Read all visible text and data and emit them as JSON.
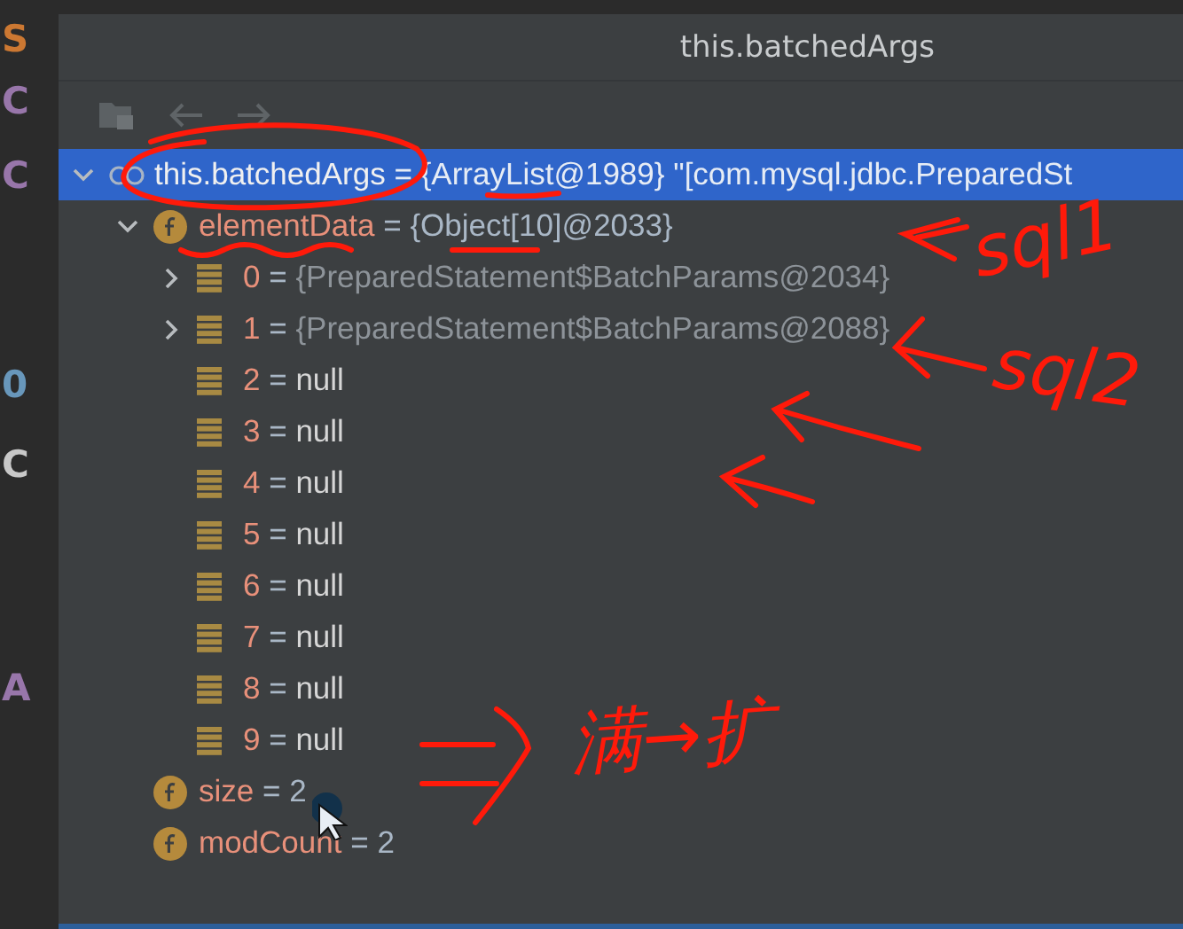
{
  "editor_gutter": [
    {
      "text": "S",
      "color": "#cc7832"
    },
    {
      "text": "C",
      "color": "#9876aa"
    },
    {
      "text": "C",
      "color": "#9876aa"
    },
    {
      "text": "0",
      "color": "#6897bb"
    },
    {
      "text": "C",
      "color": "#c8c8c8"
    },
    {
      "text": "A",
      "color": "#9876aa"
    }
  ],
  "popup": {
    "title": "this.batchedArgs"
  },
  "tree": [
    {
      "kind": "object",
      "name": "this.batchedArgs",
      "sep": "=",
      "value": "{ArrayList@1989} \"[com.mysql.jdbc.PreparedSt",
      "expanded": true,
      "selected": true,
      "children": [
        {
          "kind": "field",
          "name": "elementData",
          "sep": "=",
          "value": "{Object[10]@2033}",
          "expanded": true,
          "selected": false,
          "children": [
            {
              "kind": "element",
              "name": "0",
              "sep": "=",
              "value": "{PreparedStatement$BatchParams@2034}",
              "expanded": false,
              "selected": false
            },
            {
              "kind": "element",
              "name": "1",
              "sep": "=",
              "value": "{PreparedStatement$BatchParams@2088}",
              "expanded": false,
              "selected": false
            },
            {
              "kind": "element",
              "name": "2",
              "sep": "=",
              "value": "null",
              "selected": false
            },
            {
              "kind": "element",
              "name": "3",
              "sep": "=",
              "value": "null",
              "selected": false
            },
            {
              "kind": "element",
              "name": "4",
              "sep": "=",
              "value": "null",
              "selected": false
            },
            {
              "kind": "element",
              "name": "5",
              "sep": "=",
              "value": "null",
              "selected": false
            },
            {
              "kind": "element",
              "name": "6",
              "sep": "=",
              "value": "null",
              "selected": false
            },
            {
              "kind": "element",
              "name": "7",
              "sep": "=",
              "value": "null",
              "selected": false
            },
            {
              "kind": "element",
              "name": "8",
              "sep": "=",
              "value": "null",
              "selected": false
            },
            {
              "kind": "element",
              "name": "9",
              "sep": "=",
              "value": "null",
              "selected": false
            }
          ]
        },
        {
          "kind": "field",
          "name": "size",
          "sep": "=",
          "value": "2",
          "selected": false
        },
        {
          "kind": "field",
          "name": "modCount",
          "sep": "=",
          "value": "2",
          "selected": false
        }
      ]
    }
  ],
  "annotations": [
    {
      "text": "sql1"
    },
    {
      "text": "sql2"
    },
    {
      "text": "满→扩"
    }
  ]
}
